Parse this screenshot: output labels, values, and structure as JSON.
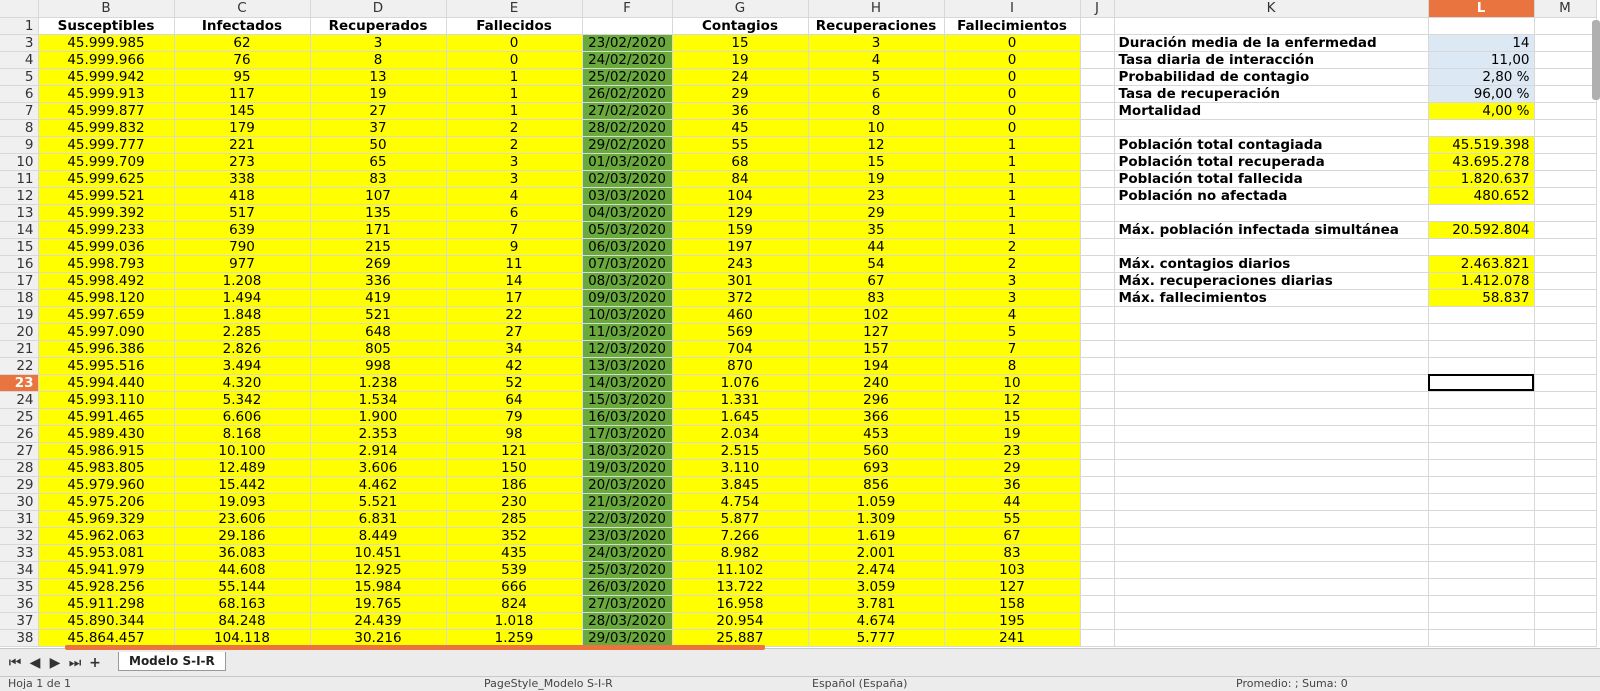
{
  "columns": [
    "B",
    "C",
    "D",
    "E",
    "F",
    "G",
    "H",
    "I",
    "J",
    "K",
    "L",
    "M"
  ],
  "active_column": "L",
  "active_row": 23,
  "header_row_number": 1,
  "headers": {
    "B": "Susceptibles",
    "C": "Infectados",
    "D": "Recuperados",
    "E": "Fallecidos",
    "F": "",
    "G": "Contagios",
    "H": "Recuperaciones",
    "I": "Fallecimientos"
  },
  "rows": [
    {
      "n": 3,
      "B": "45.999.985",
      "C": "62",
      "D": "3",
      "E": "0",
      "F": "23/02/2020",
      "G": "15",
      "H": "3",
      "I": "0"
    },
    {
      "n": 4,
      "B": "45.999.966",
      "C": "76",
      "D": "8",
      "E": "0",
      "F": "24/02/2020",
      "G": "19",
      "H": "4",
      "I": "0"
    },
    {
      "n": 5,
      "B": "45.999.942",
      "C": "95",
      "D": "13",
      "E": "1",
      "F": "25/02/2020",
      "G": "24",
      "H": "5",
      "I": "0"
    },
    {
      "n": 6,
      "B": "45.999.913",
      "C": "117",
      "D": "19",
      "E": "1",
      "F": "26/02/2020",
      "G": "29",
      "H": "6",
      "I": "0"
    },
    {
      "n": 7,
      "B": "45.999.877",
      "C": "145",
      "D": "27",
      "E": "1",
      "F": "27/02/2020",
      "G": "36",
      "H": "8",
      "I": "0"
    },
    {
      "n": 8,
      "B": "45.999.832",
      "C": "179",
      "D": "37",
      "E": "2",
      "F": "28/02/2020",
      "G": "45",
      "H": "10",
      "I": "0"
    },
    {
      "n": 9,
      "B": "45.999.777",
      "C": "221",
      "D": "50",
      "E": "2",
      "F": "29/02/2020",
      "G": "55",
      "H": "12",
      "I": "1"
    },
    {
      "n": 10,
      "B": "45.999.709",
      "C": "273",
      "D": "65",
      "E": "3",
      "F": "01/03/2020",
      "G": "68",
      "H": "15",
      "I": "1"
    },
    {
      "n": 11,
      "B": "45.999.625",
      "C": "338",
      "D": "83",
      "E": "3",
      "F": "02/03/2020",
      "G": "84",
      "H": "19",
      "I": "1"
    },
    {
      "n": 12,
      "B": "45.999.521",
      "C": "418",
      "D": "107",
      "E": "4",
      "F": "03/03/2020",
      "G": "104",
      "H": "23",
      "I": "1"
    },
    {
      "n": 13,
      "B": "45.999.392",
      "C": "517",
      "D": "135",
      "E": "6",
      "F": "04/03/2020",
      "G": "129",
      "H": "29",
      "I": "1"
    },
    {
      "n": 14,
      "B": "45.999.233",
      "C": "639",
      "D": "171",
      "E": "7",
      "F": "05/03/2020",
      "G": "159",
      "H": "35",
      "I": "1"
    },
    {
      "n": 15,
      "B": "45.999.036",
      "C": "790",
      "D": "215",
      "E": "9",
      "F": "06/03/2020",
      "G": "197",
      "H": "44",
      "I": "2"
    },
    {
      "n": 16,
      "B": "45.998.793",
      "C": "977",
      "D": "269",
      "E": "11",
      "F": "07/03/2020",
      "G": "243",
      "H": "54",
      "I": "2"
    },
    {
      "n": 17,
      "B": "45.998.492",
      "C": "1.208",
      "D": "336",
      "E": "14",
      "F": "08/03/2020",
      "G": "301",
      "H": "67",
      "I": "3"
    },
    {
      "n": 18,
      "B": "45.998.120",
      "C": "1.494",
      "D": "419",
      "E": "17",
      "F": "09/03/2020",
      "G": "372",
      "H": "83",
      "I": "3"
    },
    {
      "n": 19,
      "B": "45.997.659",
      "C": "1.848",
      "D": "521",
      "E": "22",
      "F": "10/03/2020",
      "G": "460",
      "H": "102",
      "I": "4"
    },
    {
      "n": 20,
      "B": "45.997.090",
      "C": "2.285",
      "D": "648",
      "E": "27",
      "F": "11/03/2020",
      "G": "569",
      "H": "127",
      "I": "5"
    },
    {
      "n": 21,
      "B": "45.996.386",
      "C": "2.826",
      "D": "805",
      "E": "34",
      "F": "12/03/2020",
      "G": "704",
      "H": "157",
      "I": "7"
    },
    {
      "n": 22,
      "B": "45.995.516",
      "C": "3.494",
      "D": "998",
      "E": "42",
      "F": "13/03/2020",
      "G": "870",
      "H": "194",
      "I": "8"
    },
    {
      "n": 23,
      "B": "45.994.440",
      "C": "4.320",
      "D": "1.238",
      "E": "52",
      "F": "14/03/2020",
      "G": "1.076",
      "H": "240",
      "I": "10"
    },
    {
      "n": 24,
      "B": "45.993.110",
      "C": "5.342",
      "D": "1.534",
      "E": "64",
      "F": "15/03/2020",
      "G": "1.331",
      "H": "296",
      "I": "12"
    },
    {
      "n": 25,
      "B": "45.991.465",
      "C": "6.606",
      "D": "1.900",
      "E": "79",
      "F": "16/03/2020",
      "G": "1.645",
      "H": "366",
      "I": "15"
    },
    {
      "n": 26,
      "B": "45.989.430",
      "C": "8.168",
      "D": "2.353",
      "E": "98",
      "F": "17/03/2020",
      "G": "2.034",
      "H": "453",
      "I": "19"
    },
    {
      "n": 27,
      "B": "45.986.915",
      "C": "10.100",
      "D": "2.914",
      "E": "121",
      "F": "18/03/2020",
      "G": "2.515",
      "H": "560",
      "I": "23"
    },
    {
      "n": 28,
      "B": "45.983.805",
      "C": "12.489",
      "D": "3.606",
      "E": "150",
      "F": "19/03/2020",
      "G": "3.110",
      "H": "693",
      "I": "29"
    },
    {
      "n": 29,
      "B": "45.979.960",
      "C": "15.442",
      "D": "4.462",
      "E": "186",
      "F": "20/03/2020",
      "G": "3.845",
      "H": "856",
      "I": "36"
    },
    {
      "n": 30,
      "B": "45.975.206",
      "C": "19.093",
      "D": "5.521",
      "E": "230",
      "F": "21/03/2020",
      "G": "4.754",
      "H": "1.059",
      "I": "44"
    },
    {
      "n": 31,
      "B": "45.969.329",
      "C": "23.606",
      "D": "6.831",
      "E": "285",
      "F": "22/03/2020",
      "G": "5.877",
      "H": "1.309",
      "I": "55"
    },
    {
      "n": 32,
      "B": "45.962.063",
      "C": "29.186",
      "D": "8.449",
      "E": "352",
      "F": "23/03/2020",
      "G": "7.266",
      "H": "1.619",
      "I": "67"
    },
    {
      "n": 33,
      "B": "45.953.081",
      "C": "36.083",
      "D": "10.451",
      "E": "435",
      "F": "24/03/2020",
      "G": "8.982",
      "H": "2.001",
      "I": "83"
    },
    {
      "n": 34,
      "B": "45.941.979",
      "C": "44.608",
      "D": "12.925",
      "E": "539",
      "F": "25/03/2020",
      "G": "11.102",
      "H": "2.474",
      "I": "103"
    },
    {
      "n": 35,
      "B": "45.928.256",
      "C": "55.144",
      "D": "15.984",
      "E": "666",
      "F": "26/03/2020",
      "G": "13.722",
      "H": "3.059",
      "I": "127"
    },
    {
      "n": 36,
      "B": "45.911.298",
      "C": "68.163",
      "D": "19.765",
      "E": "824",
      "F": "27/03/2020",
      "G": "16.958",
      "H": "3.781",
      "I": "158"
    },
    {
      "n": 37,
      "B": "45.890.344",
      "C": "84.248",
      "D": "24.439",
      "E": "1.018",
      "F": "28/03/2020",
      "G": "20.954",
      "H": "4.674",
      "I": "195"
    },
    {
      "n": 38,
      "B": "45.864.457",
      "C": "104.118",
      "D": "30.216",
      "E": "1.259",
      "F": "29/03/2020",
      "G": "25.887",
      "H": "5.777",
      "I": "241"
    }
  ],
  "summary": [
    {
      "row": 3,
      "label": "Duración media de la enfermedad",
      "value": "14",
      "style": "blue"
    },
    {
      "row": 4,
      "label": "Tasa diaria de interacción",
      "value": "11,00",
      "style": "blue"
    },
    {
      "row": 5,
      "label": "Probabilidad de contagio",
      "value": "2,80 %",
      "style": "blue"
    },
    {
      "row": 6,
      "label": "Tasa de recuperación",
      "value": "96,00 %",
      "style": "blue"
    },
    {
      "row": 7,
      "label": "Mortalidad",
      "value": "4,00 %",
      "style": "yellow"
    },
    {
      "row": 9,
      "label": "Población total contagiada",
      "value": "45.519.398",
      "style": "yellow"
    },
    {
      "row": 10,
      "label": "Población total recuperada",
      "value": "43.695.278",
      "style": "yellow"
    },
    {
      "row": 11,
      "label": "Población total fallecida",
      "value": "1.820.637",
      "style": "yellow"
    },
    {
      "row": 12,
      "label": "Población no afectada",
      "value": "480.652",
      "style": "yellow"
    },
    {
      "row": 14,
      "label": "Máx. población infectada simultánea",
      "value": "20.592.804",
      "style": "yellow"
    },
    {
      "row": 16,
      "label": "Máx. contagios diarios",
      "value": "2.463.821",
      "style": "yellow"
    },
    {
      "row": 17,
      "label": "Máx. recuperaciones diarias",
      "value": "1.412.078",
      "style": "yellow"
    },
    {
      "row": 18,
      "label": "Máx. fallecimientos",
      "value": "58.837",
      "style": "yellow"
    }
  ],
  "sheet_tabs": {
    "add_label": "+",
    "active_tab": "Modelo S-I-R"
  },
  "nav_icons": [
    "first-sheet-icon",
    "prev-sheet-icon",
    "next-sheet-icon",
    "last-sheet-icon"
  ],
  "statusbar": {
    "sheet_info": "Hoja 1 de 1",
    "page_style": "PageStyle_Modelo S-I-R",
    "language": "Español (España)",
    "summary": "Promedio: ; Suma: 0"
  },
  "colors": {
    "yellow": "#ffff00",
    "green": "#6aaa3d",
    "blue": "#dde8f5",
    "accent": "#e9743f"
  }
}
